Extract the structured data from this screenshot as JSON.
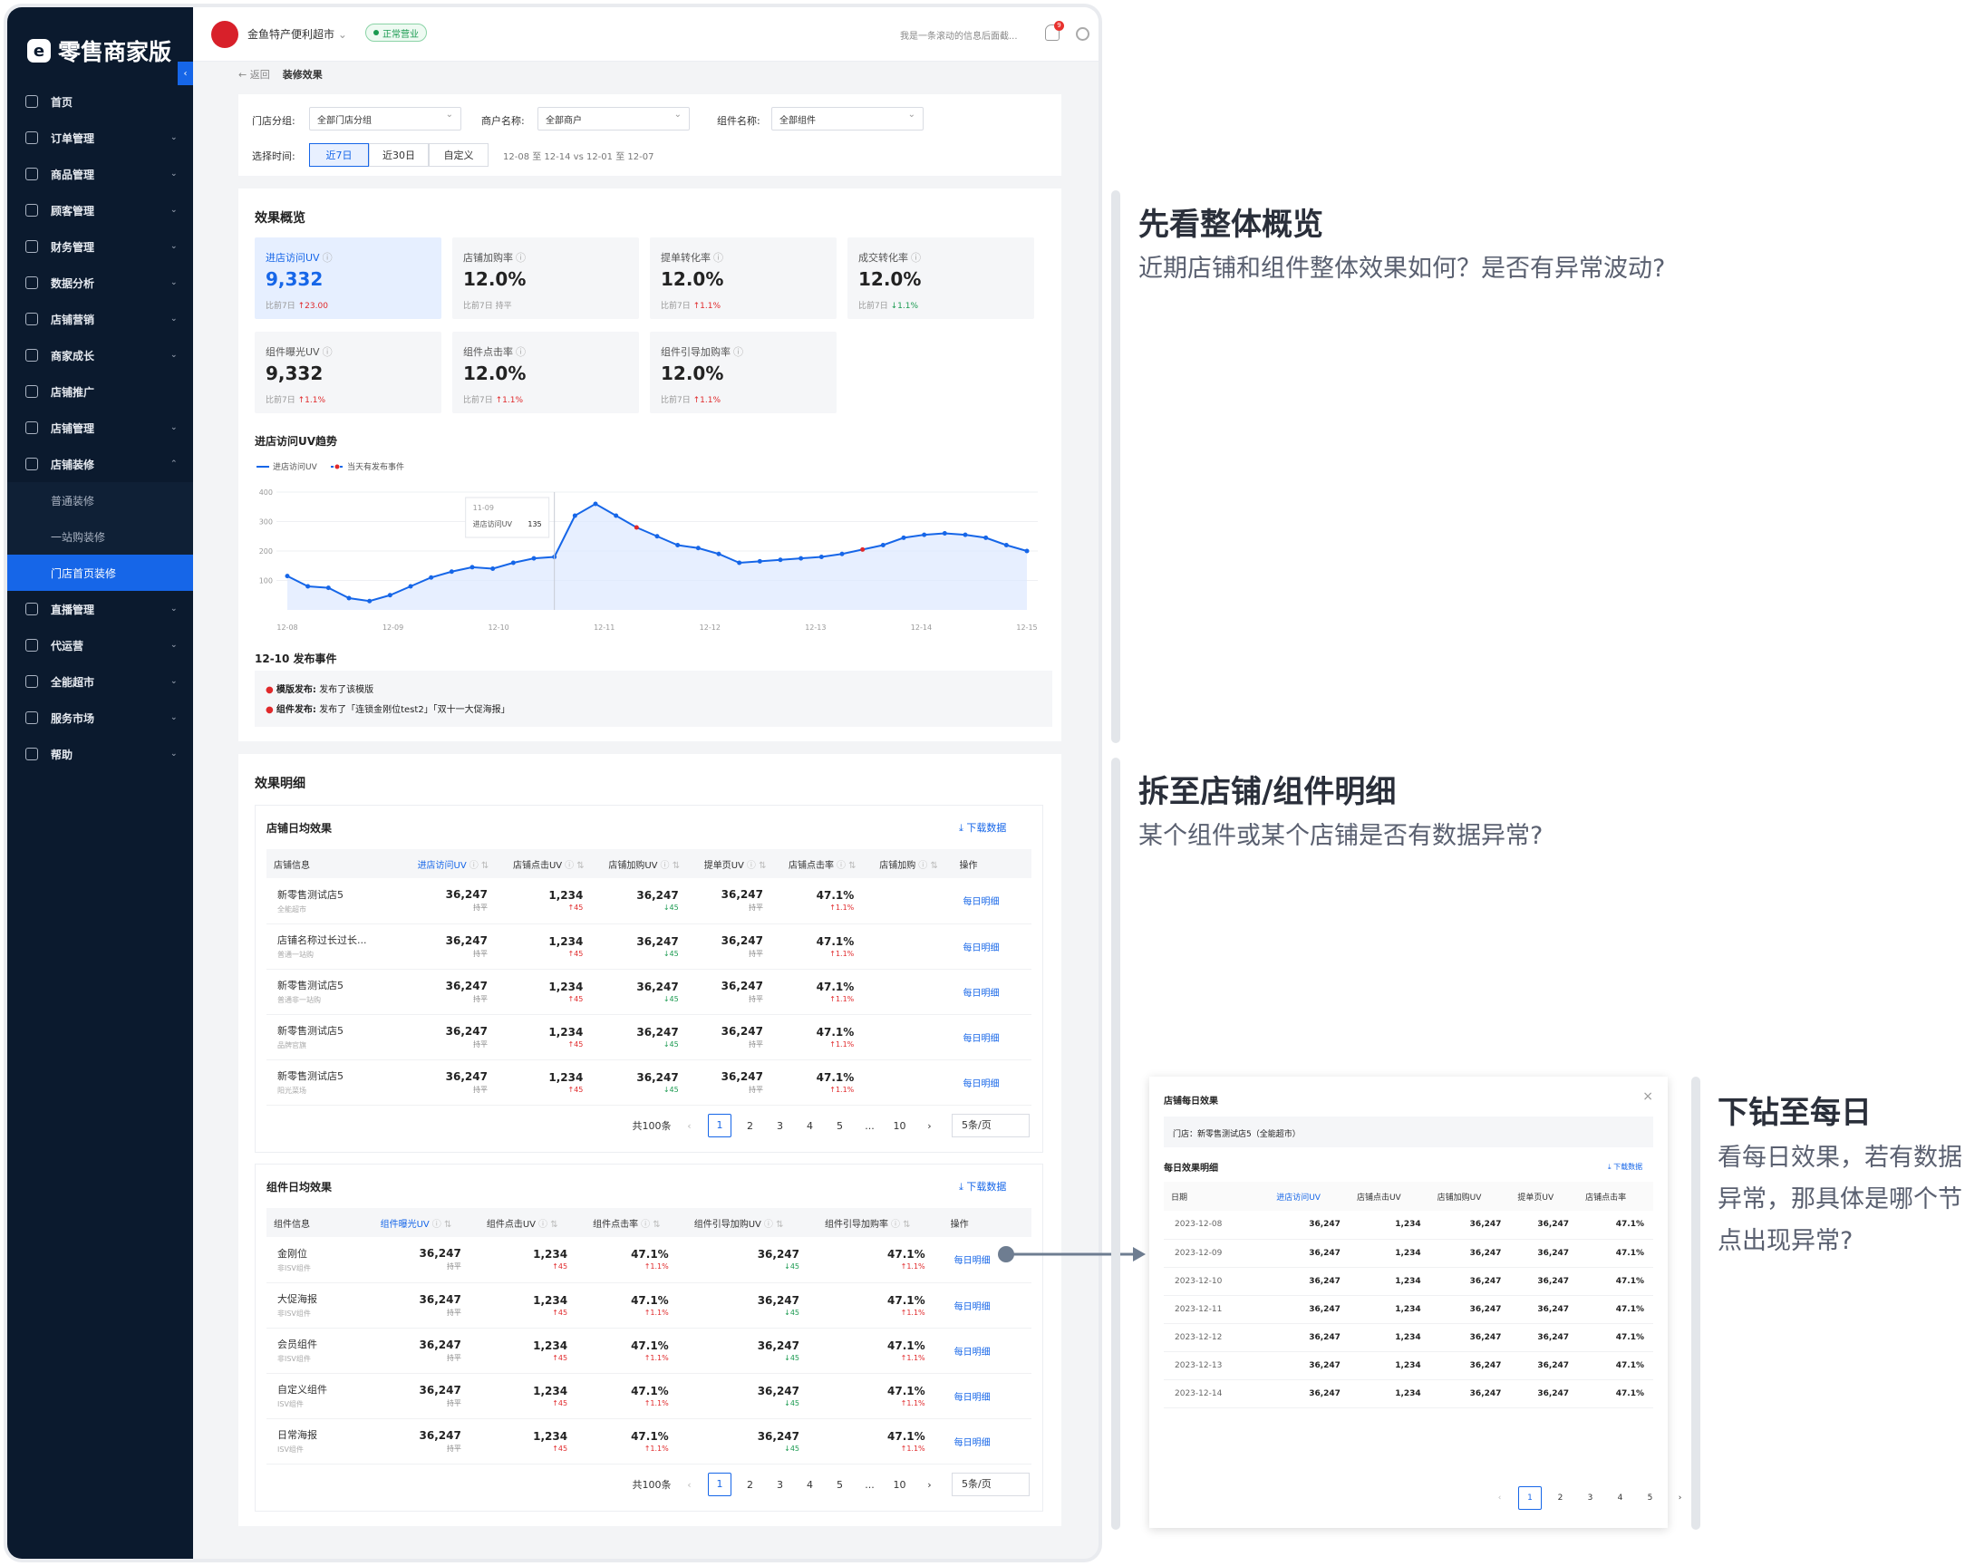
{
  "app": {
    "logo": "零售商家版",
    "store": "金鱼特产便利超市",
    "status": "正常营业",
    "ticker": "我是一条滚动的信息后面截...",
    "notif": "9"
  },
  "menu": [
    {
      "label": "首页",
      "arrow": false
    },
    {
      "label": "订单管理",
      "arrow": true
    },
    {
      "label": "商品管理",
      "arrow": true
    },
    {
      "label": "顾客管理",
      "arrow": true
    },
    {
      "label": "财务管理",
      "arrow": true
    },
    {
      "label": "数据分析",
      "arrow": true
    },
    {
      "label": "店铺营销",
      "arrow": true
    },
    {
      "label": "商家成长",
      "arrow": true
    },
    {
      "label": "店铺推广",
      "arrow": false
    },
    {
      "label": "店铺管理",
      "arrow": true
    },
    {
      "label": "店铺装修",
      "arrow": true,
      "open": true
    },
    {
      "label": "普通装修",
      "sub": true
    },
    {
      "label": "一站购装修",
      "sub": true
    },
    {
      "label": "门店首页装修",
      "sub": true,
      "active": true
    },
    {
      "label": "直播管理",
      "arrow": true
    },
    {
      "label": "代运营",
      "arrow": true
    },
    {
      "label": "全能超市",
      "arrow": true
    },
    {
      "label": "服务市场",
      "arrow": true
    },
    {
      "label": "帮助",
      "arrow": true
    }
  ],
  "breadcrumb": {
    "back": "返回",
    "title": "装修效果"
  },
  "filters": {
    "group_label": "门店分组:",
    "group_val": "全部门店分组",
    "merchant_label": "商户名称:",
    "merchant_val": "全部商户",
    "comp_label": "组件名称:",
    "comp_val": "全部组件",
    "time_label": "选择时间:",
    "seg": [
      "近7日",
      "近30日",
      "自定义"
    ],
    "range": "12-08 至 12-14 vs 12-01 至 12-07"
  },
  "overview": {
    "title": "效果概览",
    "kpis": [
      {
        "label": "进店访问UV",
        "value": "9,332",
        "cmp": "比前7日",
        "delta": "↑23.00",
        "dir": "r"
      },
      {
        "label": "店铺加购率",
        "value": "12.0%",
        "cmp": "比前7日",
        "delta": "持平",
        "dir": ""
      },
      {
        "label": "提单转化率",
        "value": "12.0%",
        "cmp": "比前7日",
        "delta": "↑1.1%",
        "dir": "r"
      },
      {
        "label": "成交转化率",
        "value": "12.0%",
        "cmp": "比前7日",
        "delta": "↓1.1%",
        "dir": "g"
      },
      {
        "label": "组件曝光UV",
        "value": "9,332",
        "cmp": "比前7日",
        "delta": "↑1.1%",
        "dir": "r"
      },
      {
        "label": "组件点击率",
        "value": "12.0%",
        "cmp": "比前7日",
        "delta": "↑1.1%",
        "dir": "r"
      },
      {
        "label": "组件引导加购率",
        "value": "12.0%",
        "cmp": "比前7日",
        "delta": "↑1.1%",
        "dir": "r"
      }
    ]
  },
  "chart_data": {
    "type": "line",
    "title": "进店访问UV趋势",
    "legend": [
      "进店访问UV",
      "当天有发布事件"
    ],
    "x": [
      "12-08",
      "12-09",
      "12-10",
      "12-11",
      "12-12",
      "12-13",
      "12-14",
      "12-15"
    ],
    "ylim": [
      0,
      400
    ],
    "yticks": [
      100,
      200,
      300,
      400
    ],
    "values": [
      115,
      80,
      75,
      40,
      30,
      50,
      80,
      110,
      130,
      145,
      140,
      160,
      175,
      180,
      320,
      360,
      320,
      280,
      250,
      220,
      210,
      190,
      160,
      165,
      170,
      175,
      180,
      190,
      205,
      220,
      245,
      255,
      260,
      255,
      245,
      220,
      200
    ],
    "events": [
      17,
      28
    ],
    "tooltip": {
      "date": "11-09",
      "label": "进店访问UV",
      "value": "135"
    }
  },
  "event": {
    "title": "12-10 发布事件",
    "items": [
      {
        "k": "模版发布:",
        "v": "发布了该模版"
      },
      {
        "k": "组件发布:",
        "v": "发布了「连锁金刚位test2」「双十一大促海报」"
      }
    ]
  },
  "detail": {
    "title": "效果明细",
    "download": "下载数据",
    "store": {
      "title": "店铺日均效果",
      "cols": [
        "店铺信息",
        "进店访问UV",
        "店铺点击UV",
        "店铺加购UV",
        "提单页UV",
        "店铺点击率",
        "店铺加购",
        "操作"
      ],
      "rows": [
        [
          "新零售测试店5",
          "全能超市"
        ],
        [
          "店铺名称过长过长...",
          "普通一站购"
        ],
        [
          "新零售测试店5",
          "普通非一站购"
        ],
        [
          "新零售测试店5",
          "品牌官旗"
        ],
        [
          "新零售测试店5",
          "阳光菜场"
        ]
      ]
    },
    "comp": {
      "title": "组件日均效果",
      "cols": [
        "组件信息",
        "组件曝光UV",
        "组件点击UV",
        "组件点击率",
        "组件引导加购UV",
        "组件引导加购率",
        "操作"
      ],
      "rows": [
        [
          "金刚位",
          "非ISV组件"
        ],
        [
          "大促海报",
          "非ISV组件"
        ],
        [
          "会员组件",
          "非ISV组件"
        ],
        [
          "自定义组件",
          "ISV组件"
        ],
        [
          "日常海报",
          "ISV组件"
        ]
      ]
    },
    "vals": {
      "a": "36,247",
      "a_d": "持平",
      "b": "1,234",
      "b_d": "↑45",
      "c": "36,247",
      "c_d": "↓45",
      "p": "47.1%",
      "p_d": "↑1.1%"
    },
    "op": "每日明细",
    "pager": {
      "total": "共100条",
      "pages": [
        "1",
        "2",
        "3",
        "4",
        "5",
        "...",
        "10"
      ],
      "size": "5条/页"
    }
  },
  "annotations": [
    {
      "title": "先看整体概览",
      "desc": "近期店铺和组件整体效果如何？是否有异常波动?"
    },
    {
      "title": "拆至店铺/组件明细",
      "desc": "某个组件或某个店铺是否有数据异常?"
    },
    {
      "title": "下钻至每日",
      "desc": "看每日效果，若有数据异常，那具体是哪个节点出现异常?"
    }
  ],
  "popup": {
    "title": "店铺每日效果",
    "store": "门店：新零售测试店5（全能超市）",
    "sub": "每日效果明细",
    "download": "下载数据",
    "cols": [
      "日期",
      "进店访问UV",
      "店铺点击UV",
      "店铺加购UV",
      "提单页UV",
      "店铺点击率"
    ],
    "dates": [
      "2023-12-08",
      "2023-12-09",
      "2023-12-10",
      "2023-12-11",
      "2023-12-12",
      "2023-12-13",
      "2023-12-14"
    ],
    "vals": [
      "36,247",
      "1,234",
      "36,247",
      "36,247",
      "47.1%"
    ],
    "pages": [
      "1",
      "2",
      "3",
      "4",
      "5"
    ]
  }
}
